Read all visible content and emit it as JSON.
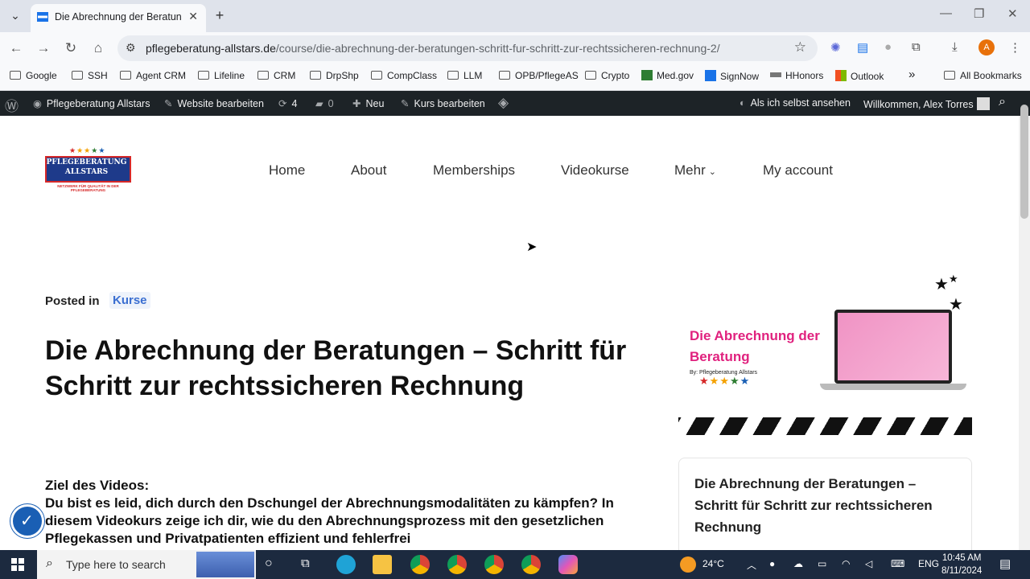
{
  "browser": {
    "tab_title": "Die Abrechnung der Beratunge",
    "tab_close": "✕",
    "new_tab": "+",
    "url_host": "pflegeberatung-allstars.de",
    "url_path": "/course/die-abrechnung-der-beratungen-schritt-fur-schritt-zur-rechtssicheren-rechnung-2/",
    "profile_initial": "A"
  },
  "bookmarks": [
    "Google",
    "SSH",
    "Agent CRM",
    "Lifeline",
    "CRM",
    "DrpShp",
    "CompClass",
    "LLM",
    "OPB/PflegeAS",
    "Crypto",
    "Med.gov",
    "SignNow",
    "HHonors",
    "Outlook"
  ],
  "bookmarks_more": "»",
  "all_bookmarks": "All Bookmarks",
  "adminbar": {
    "site": "Pflegeberatung Allstars",
    "edit_site": "Website bearbeiten",
    "updates": "4",
    "comments": "0",
    "new": "Neu",
    "edit_course": "Kurs bearbeiten",
    "notif": "0",
    "view_as": "Als ich selbst ansehen",
    "welcome": "Willkommen, Alex Torres"
  },
  "logo": {
    "line1": "PFLEGEBERATUNG",
    "line2": "ALLSTARS",
    "tagline": "NETZWERK FÜR QUALITÄT IN DER PFLEGEBERATUNG"
  },
  "nav": [
    "Home",
    "About",
    "Memberships",
    "Videokurse",
    "Mehr",
    "My account"
  ],
  "post": {
    "posted_in": "Posted in",
    "category": "Kurse",
    "title": "Die Abrechnung der Beratungen – Schritt für Schritt zur rechtssicheren Rechnung",
    "goal_label": "Ziel des Videos:",
    "body": "Du bist es leid, dich durch den Dschungel der Abrechnungsmodalitäten zu kämpfen? In diesem Videokurs zeige ich dir, wie du den Abrechnungsprozess mit den gesetzlichen Pflegekassen und Privatpatienten effizient und fehlerfrei"
  },
  "thumbnail": {
    "title": "Die Abrechnung der Beratung",
    "byline": "By: Pflegeberatung Allstars"
  },
  "sidebar_card": {
    "title": "Die Abrechnung der Beratungen – Schritt für Schritt zur rechtssicheren Rechnung"
  },
  "taskbar": {
    "search_placeholder": "Type here to search",
    "weather": "24°C",
    "language": "ENG",
    "time": "10:45 AM",
    "date": "8/11/2024"
  },
  "colors": {
    "admin_bar": "#1d2327",
    "accent_link": "#3b6fd1",
    "thumbnail_title": "#e0217e",
    "taskbar": "#1c2a3f"
  }
}
